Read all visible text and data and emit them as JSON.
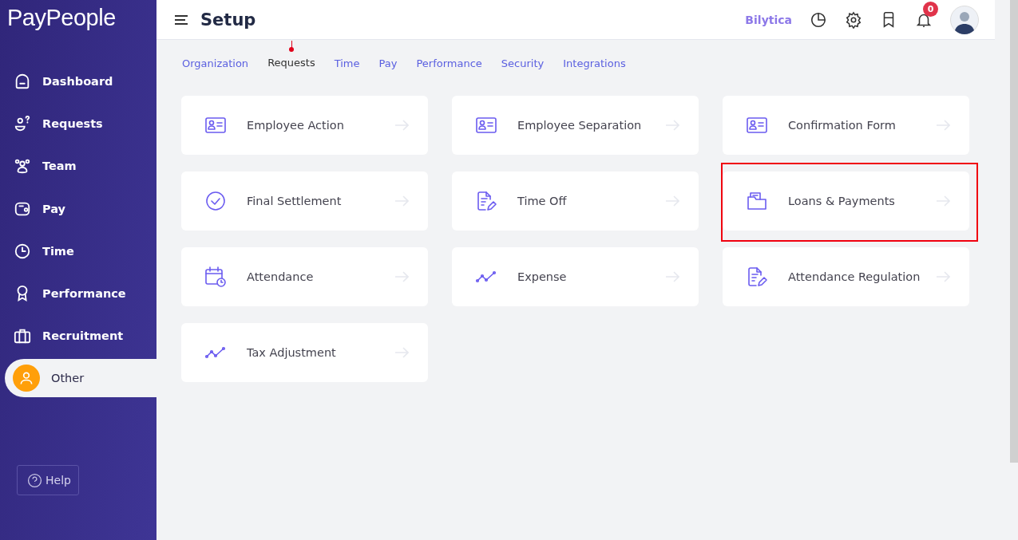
{
  "logo": "PayPeople",
  "sidebar": {
    "items": [
      {
        "label": "Dashboard",
        "kind": "home",
        "selected": false
      },
      {
        "label": "Requests",
        "kind": "requests",
        "selected": false
      },
      {
        "label": "Team",
        "kind": "team",
        "selected": false
      },
      {
        "label": "Pay",
        "kind": "wallet",
        "selected": false
      },
      {
        "label": "Time",
        "kind": "clock",
        "selected": false
      },
      {
        "label": "Performance",
        "kind": "award",
        "selected": false
      },
      {
        "label": "Recruitment",
        "kind": "briefcase",
        "selected": false
      },
      {
        "label": "Other",
        "kind": "user",
        "selected": true
      }
    ],
    "help": "Help"
  },
  "header": {
    "title": "Setup",
    "company": "Bilytica",
    "notifications": "0"
  },
  "tabs": [
    {
      "label": "Organization",
      "selected": false
    },
    {
      "label": "Requests",
      "selected": true
    },
    {
      "label": "Time",
      "selected": false
    },
    {
      "label": "Pay",
      "selected": false
    },
    {
      "label": "Performance",
      "selected": false
    },
    {
      "label": "Security",
      "selected": false
    },
    {
      "label": "Integrations",
      "selected": false
    }
  ],
  "cards": [
    {
      "label": "Employee Action",
      "kind": "id-card",
      "highlighted": false
    },
    {
      "label": "Employee Separation",
      "kind": "id-card",
      "highlighted": false
    },
    {
      "label": "Confirmation Form",
      "kind": "id-card",
      "highlighted": false
    },
    {
      "label": "Final Settlement",
      "kind": "check",
      "highlighted": false
    },
    {
      "label": "Time Off",
      "kind": "document",
      "highlighted": false
    },
    {
      "label": "Loans & Payments",
      "kind": "folder",
      "highlighted": true
    },
    {
      "label": "Attendance",
      "kind": "calendar",
      "highlighted": false
    },
    {
      "label": "Expense",
      "kind": "trend",
      "highlighted": false
    },
    {
      "label": "Attendance Regulation",
      "kind": "document",
      "highlighted": false
    },
    {
      "label": "Tax Adjustment",
      "kind": "trend",
      "highlighted": false
    }
  ]
}
